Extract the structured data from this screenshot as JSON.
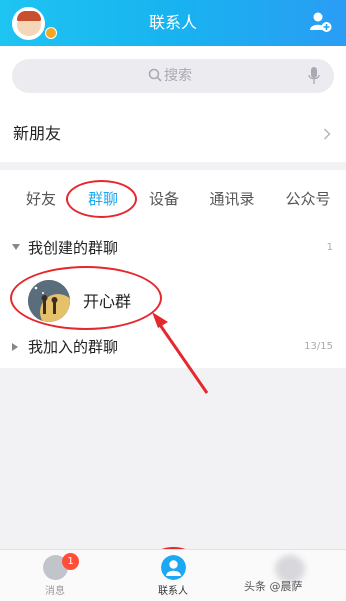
{
  "header": {
    "title": "联系人"
  },
  "search": {
    "placeholder": "搜索"
  },
  "new_friends": {
    "label": "新朋友"
  },
  "tabs": [
    {
      "label": "好友",
      "active": false
    },
    {
      "label": "群聊",
      "active": true
    },
    {
      "label": "设备",
      "active": false
    },
    {
      "label": "通讯录",
      "active": false
    },
    {
      "label": "公众号",
      "active": false
    }
  ],
  "sections": {
    "created": {
      "label": "我创建的群聊",
      "count": "1",
      "expanded": true
    },
    "joined": {
      "label": "我加入的群聊",
      "count": "13/15",
      "expanded": false
    }
  },
  "groups": [
    {
      "name": "开心群"
    }
  ],
  "bottom_nav": {
    "messages": {
      "label": "消息",
      "badge": "1"
    },
    "contacts": {
      "label": "联系人",
      "active": true
    }
  },
  "watermark": "头条 @晨萨",
  "colors": {
    "accent": "#1aa9f2",
    "annotation": "#e4282e",
    "badge": "#ff4f3a"
  }
}
